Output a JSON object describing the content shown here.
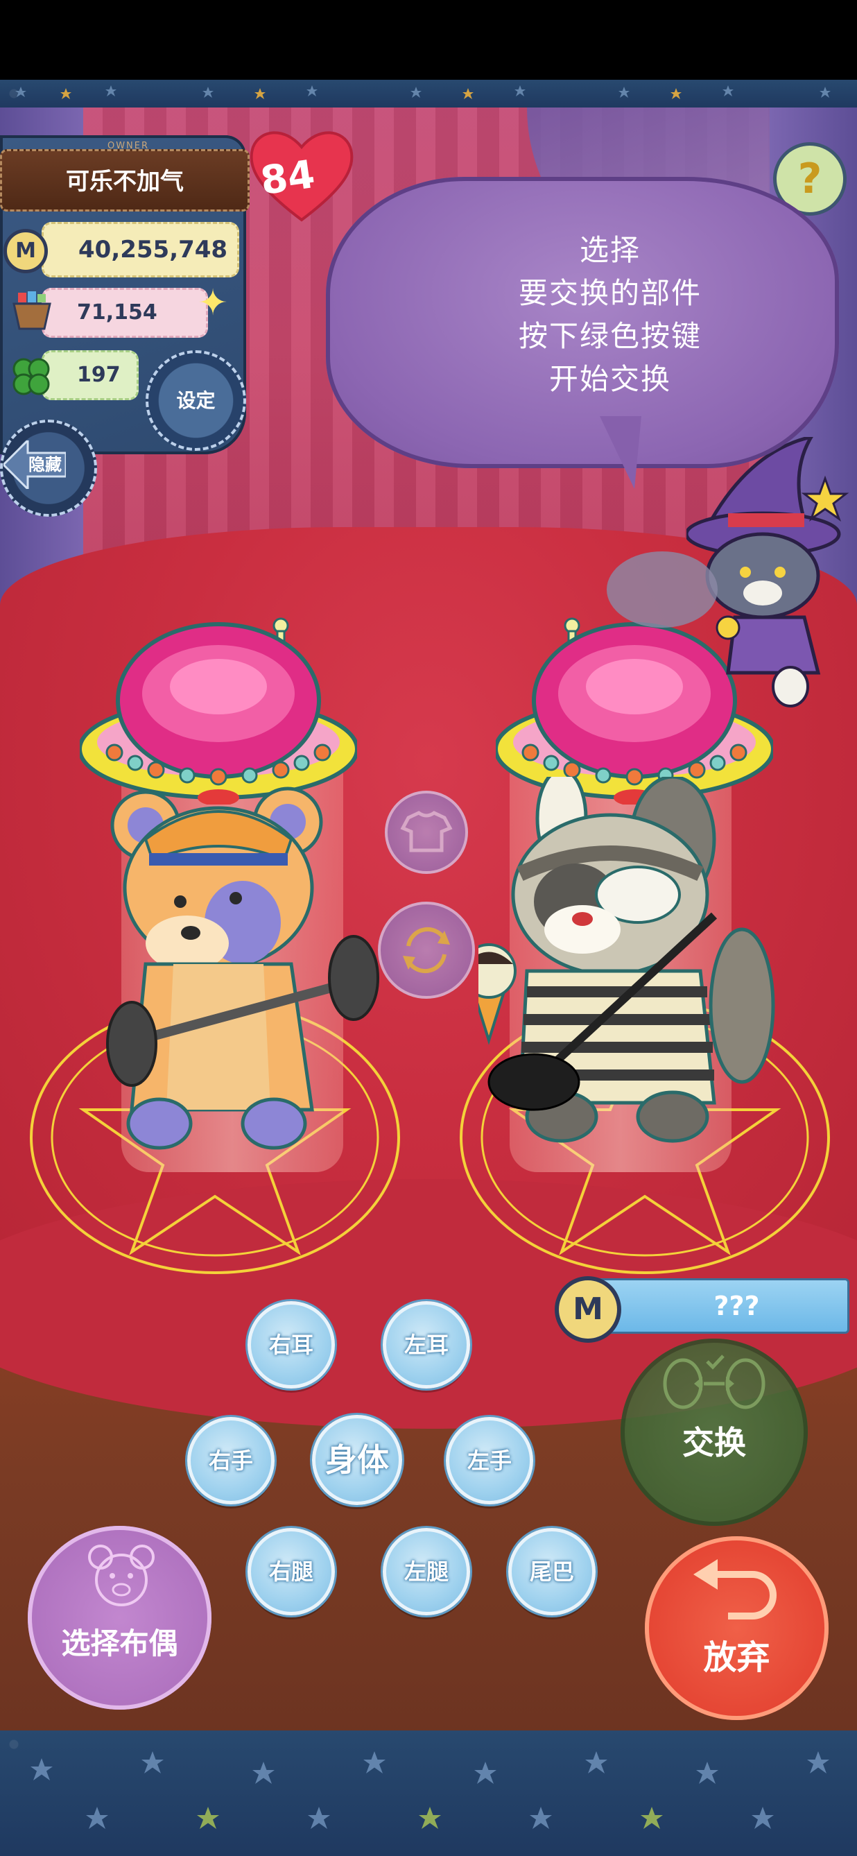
{
  "owner": {
    "tag": "OWNER",
    "name": "可乐不加气",
    "money": "40,255,748",
    "gems": "71,154",
    "clovers": "197",
    "settings_label": "设定",
    "hide_label": "隐藏"
  },
  "heart_count": "84",
  "help_label": "?",
  "instruction": {
    "line1": "选择",
    "line2": "要交换的部件",
    "line3": "按下绿色按键",
    "line4": "开始交换"
  },
  "cost": {
    "coin_label": "M",
    "value": "???"
  },
  "exchange_label": "交换",
  "parts": {
    "right_ear": "右耳",
    "left_ear": "左耳",
    "right_hand": "右手",
    "body": "身体",
    "left_hand": "左手",
    "right_leg": "右腿",
    "left_leg": "左腿",
    "tail": "尾巴"
  },
  "select_doll_label": "选择布偶",
  "give_up_label": "放弃",
  "colors": {
    "stage_red": "#c92e40",
    "part_button_blue": "#9ed1ee",
    "exchange_green": "#37612f",
    "give_up_red": "#e03a2b",
    "select_purple": "#a86ab9",
    "bubble_purple": "#8c66b2"
  }
}
